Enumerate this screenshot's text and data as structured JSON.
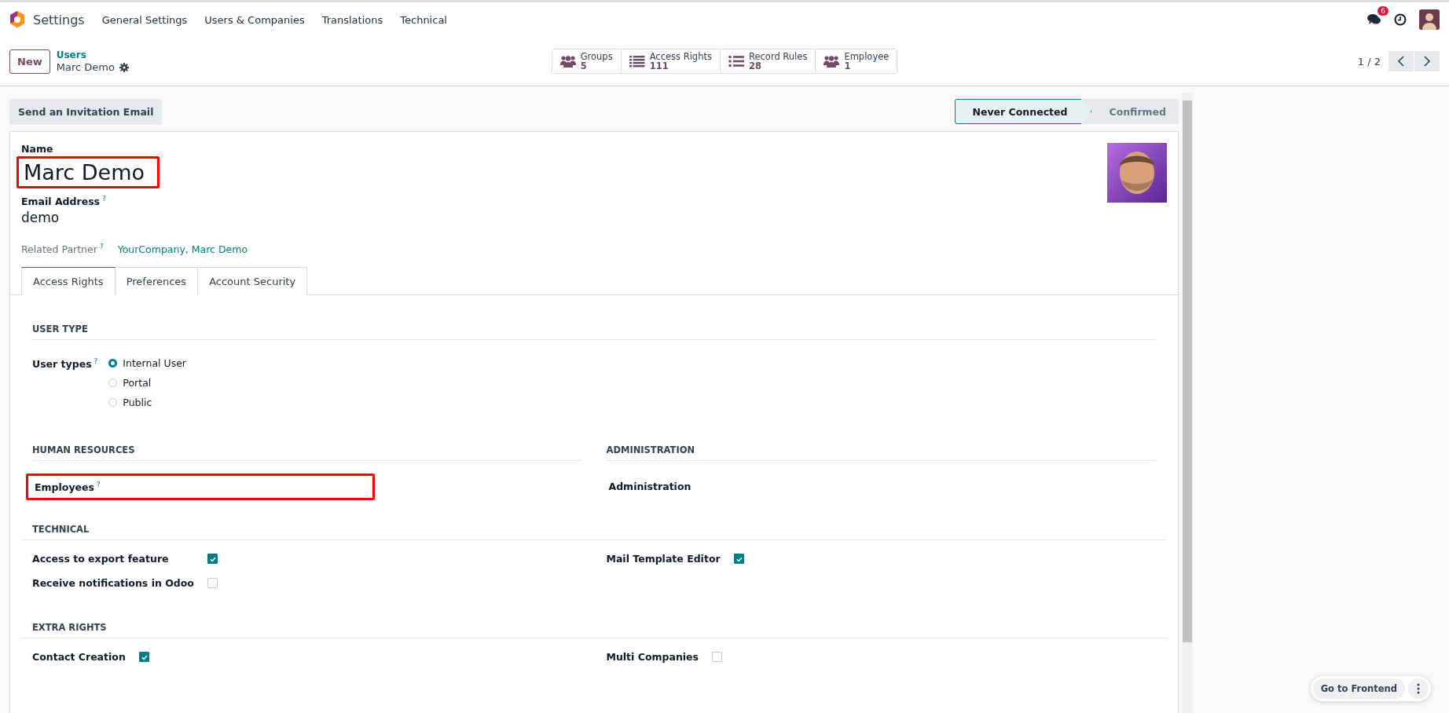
{
  "app": {
    "name": "Settings"
  },
  "menu": [
    {
      "label": "General Settings"
    },
    {
      "label": "Users & Companies"
    },
    {
      "label": "Translations"
    },
    {
      "label": "Technical"
    }
  ],
  "systray": {
    "message_count": "6"
  },
  "new_button": "New",
  "breadcrumb": {
    "parent": "Users",
    "current": "Marc Demo"
  },
  "smart_buttons": [
    {
      "kind": "people",
      "label": "Groups",
      "value": "5"
    },
    {
      "kind": "list",
      "label": "Access Rights",
      "value": "111"
    },
    {
      "kind": "bullets",
      "label": "Record Rules",
      "value": "28"
    },
    {
      "kind": "people",
      "label": "Employee",
      "value": "1"
    }
  ],
  "pager": "1 / 2",
  "action_button": "Send an Invitation Email",
  "statusbar": [
    {
      "label": "Never Connected",
      "selected": true
    },
    {
      "label": "Confirmed",
      "selected": false
    }
  ],
  "form": {
    "name_label": "Name",
    "name": "Marc Demo",
    "name_highlighted": true,
    "email_label": "Email Address",
    "email_help": "?",
    "email": "demo",
    "partner_label": "Related Partner",
    "partner_help": "?",
    "partner": "YourCompany, Marc Demo"
  },
  "tabs": [
    {
      "label": "Access Rights",
      "selected": true
    },
    {
      "label": "Preferences",
      "selected": false
    },
    {
      "label": "Account Security",
      "selected": false
    }
  ],
  "user_type": {
    "title": "USER TYPE",
    "label": "User types",
    "help": "?",
    "options": [
      {
        "label": "Internal User",
        "selected": true
      },
      {
        "label": "Portal",
        "selected": false
      },
      {
        "label": "Public",
        "selected": false
      }
    ]
  },
  "group_sections": [
    {
      "title": "HUMAN RESOURCES",
      "fields": [
        {
          "label": "Employees",
          "help": "?",
          "highlighted": true
        }
      ]
    },
    {
      "title": "ADMINISTRATION",
      "fields": [
        {
          "label": "Administration",
          "highlighted": false
        }
      ]
    }
  ],
  "check_sections": [
    {
      "title": "TECHNICAL",
      "columns": [
        [
          {
            "label": "Access to export feature",
            "checked": true
          },
          {
            "label": "Receive notifications in Odoo",
            "checked": false
          }
        ],
        [
          {
            "label": "Mail Template Editor",
            "checked": true
          }
        ]
      ]
    },
    {
      "title": "EXTRA RIGHTS",
      "columns": [
        [
          {
            "label": "Contact Creation",
            "checked": true
          }
        ],
        [
          {
            "label": "Multi Companies",
            "checked": false
          }
        ]
      ]
    }
  ],
  "frontend_button": "Go to Frontend"
}
